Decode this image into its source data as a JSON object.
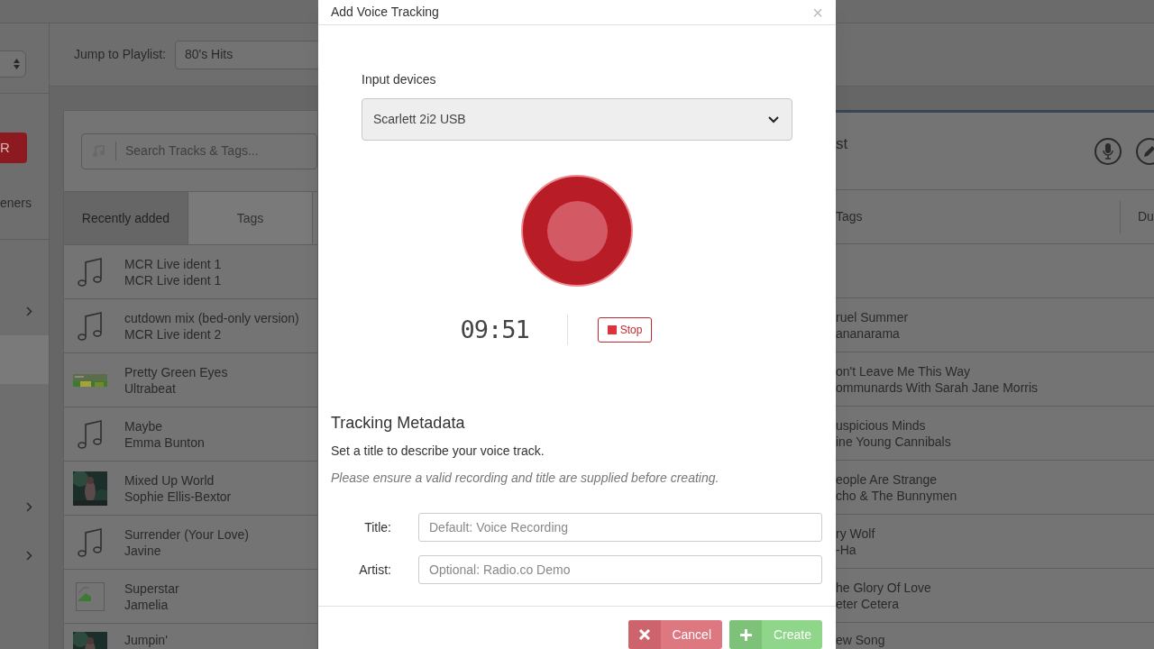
{
  "header": {
    "jump_label": "Jump to Playlist:",
    "playlist": "80's Hits"
  },
  "sidebar": {
    "button_label": "R",
    "listeners_label": "eners",
    "items": [
      {
        "selected": false,
        "expandable": true
      },
      {
        "selected": true,
        "expandable": false
      },
      {
        "selected": false,
        "expandable": true
      },
      {
        "selected": false,
        "expandable": true
      }
    ]
  },
  "library": {
    "search_placeholder": "Search Tracks & Tags...",
    "tabs": [
      {
        "label": "Recently added",
        "selected": true
      },
      {
        "label": "Tags",
        "selected": false
      }
    ],
    "tracks": [
      {
        "title": "MCR Live ident 1",
        "artist": "MCR Live ident 1",
        "kind": "note"
      },
      {
        "title": "cutdown mix (bed-only version)",
        "artist": "MCR Live ident 2",
        "kind": "note"
      },
      {
        "title": "Pretty Green Eyes",
        "artist": "Ultrabeat",
        "kind": "banner"
      },
      {
        "title": "Maybe",
        "artist": "Emma Bunton",
        "kind": "note"
      },
      {
        "title": "Mixed Up World",
        "artist": "Sophie Ellis-Bextor",
        "kind": "picture"
      },
      {
        "title": "Surrender (Your Love)",
        "artist": "Javine",
        "kind": "note"
      },
      {
        "title": "Superstar",
        "artist": "Jamelia",
        "kind": "broken"
      },
      {
        "title": "Jumpin'",
        "kind": "picture"
      }
    ]
  },
  "playlist": {
    "title": "st",
    "columns": [
      "Tags",
      "Du"
    ],
    "tracks": [
      {
        "title": "ruel Summer",
        "artist": "ananarama"
      },
      {
        "title": "on't Leave Me This Way",
        "artist": "ommunards With Sarah Jane Morris"
      },
      {
        "title": "uspicious Minds",
        "artist": "ine Young Cannibals"
      },
      {
        "title": "eople Are Strange",
        "artist": "cho & The Bunnymen"
      },
      {
        "title": "ry Wolf",
        "artist": "-Ha"
      },
      {
        "title": "he Glory Of Love",
        "artist": "eter Cetera"
      },
      {
        "title": "ew Song"
      }
    ]
  },
  "modal": {
    "title": "Add Voice Tracking",
    "close": "×",
    "device_label": "Input devices",
    "device": "Scarlett 2i2 USB",
    "recording": true,
    "timer": "09:51",
    "stop_label": "Stop",
    "section_title": "Tracking Metadata",
    "description": "Set a title to describe your voice track.",
    "hint": "Please ensure a valid recording and title are supplied before creating.",
    "fields": [
      {
        "label": "Title:",
        "placeholder": "Default: Voice Recording"
      },
      {
        "label": "Artist:",
        "placeholder": "Optional: Radio.co Demo"
      }
    ],
    "buttons": [
      {
        "kind": "cancel",
        "label": "Cancel"
      },
      {
        "kind": "create",
        "label": "Create"
      }
    ]
  }
}
